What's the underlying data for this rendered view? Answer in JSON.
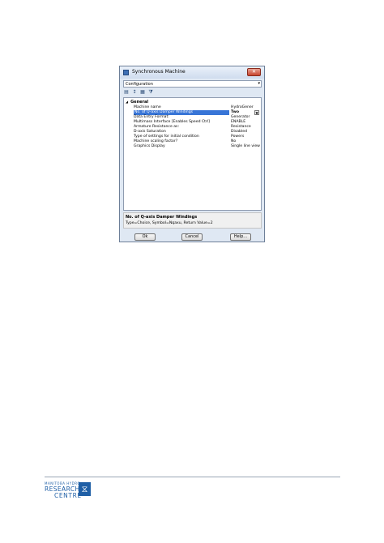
{
  "dialog": {
    "title": "Synchronous Machine",
    "close_glyph": "✕",
    "config_select": {
      "value": "Configuration",
      "arrow": "▾"
    },
    "toolbar": [
      {
        "name": "categorized-icon",
        "glyph": "▤"
      },
      {
        "name": "sort-alpha-icon",
        "glyph": "↕"
      },
      {
        "name": "properties-icon",
        "glyph": "▦"
      },
      {
        "name": "filter-icon",
        "glyph": "⧩"
      }
    ],
    "category": {
      "glyph": "◢",
      "label": "General"
    },
    "properties": [
      {
        "name": "Machine name",
        "value": "HydroGener",
        "selected": false
      },
      {
        "name": "No. of Q-axis Damper Windings",
        "value": "Two",
        "selected": true
      },
      {
        "name": "Data Entry Format:",
        "value": "Generator",
        "selected": false
      },
      {
        "name": "Multimass Interface [Enables Speed Ctrl]",
        "value": "ENABLE",
        "selected": false
      },
      {
        "name": "Armature Resistance as:",
        "value": "Resistance",
        "selected": false
      },
      {
        "name": "D-axis Saturation",
        "value": "Disabled",
        "selected": false
      },
      {
        "name": "Type of settings for initial condition",
        "value": "Powers",
        "selected": false
      },
      {
        "name": "Machine scaling factor?",
        "value": "No",
        "selected": false
      },
      {
        "name": "Graphics Display",
        "value": "Single line view",
        "selected": false
      }
    ],
    "dropdown_glyph": "▼",
    "description": {
      "title": "No. of Q-axis Damper Windings",
      "text": "Type=Choice, Symbol=Nqaxu, Return Value=2"
    },
    "buttons": {
      "ok": "Ok",
      "cancel": "Cancel",
      "help": "Help..."
    }
  },
  "footer": {
    "logo_small": "MANITOBA HYDRO",
    "logo_line1": "RESEARCH",
    "logo_line2": "CENTRE",
    "emblem_glyph": "⧖"
  }
}
